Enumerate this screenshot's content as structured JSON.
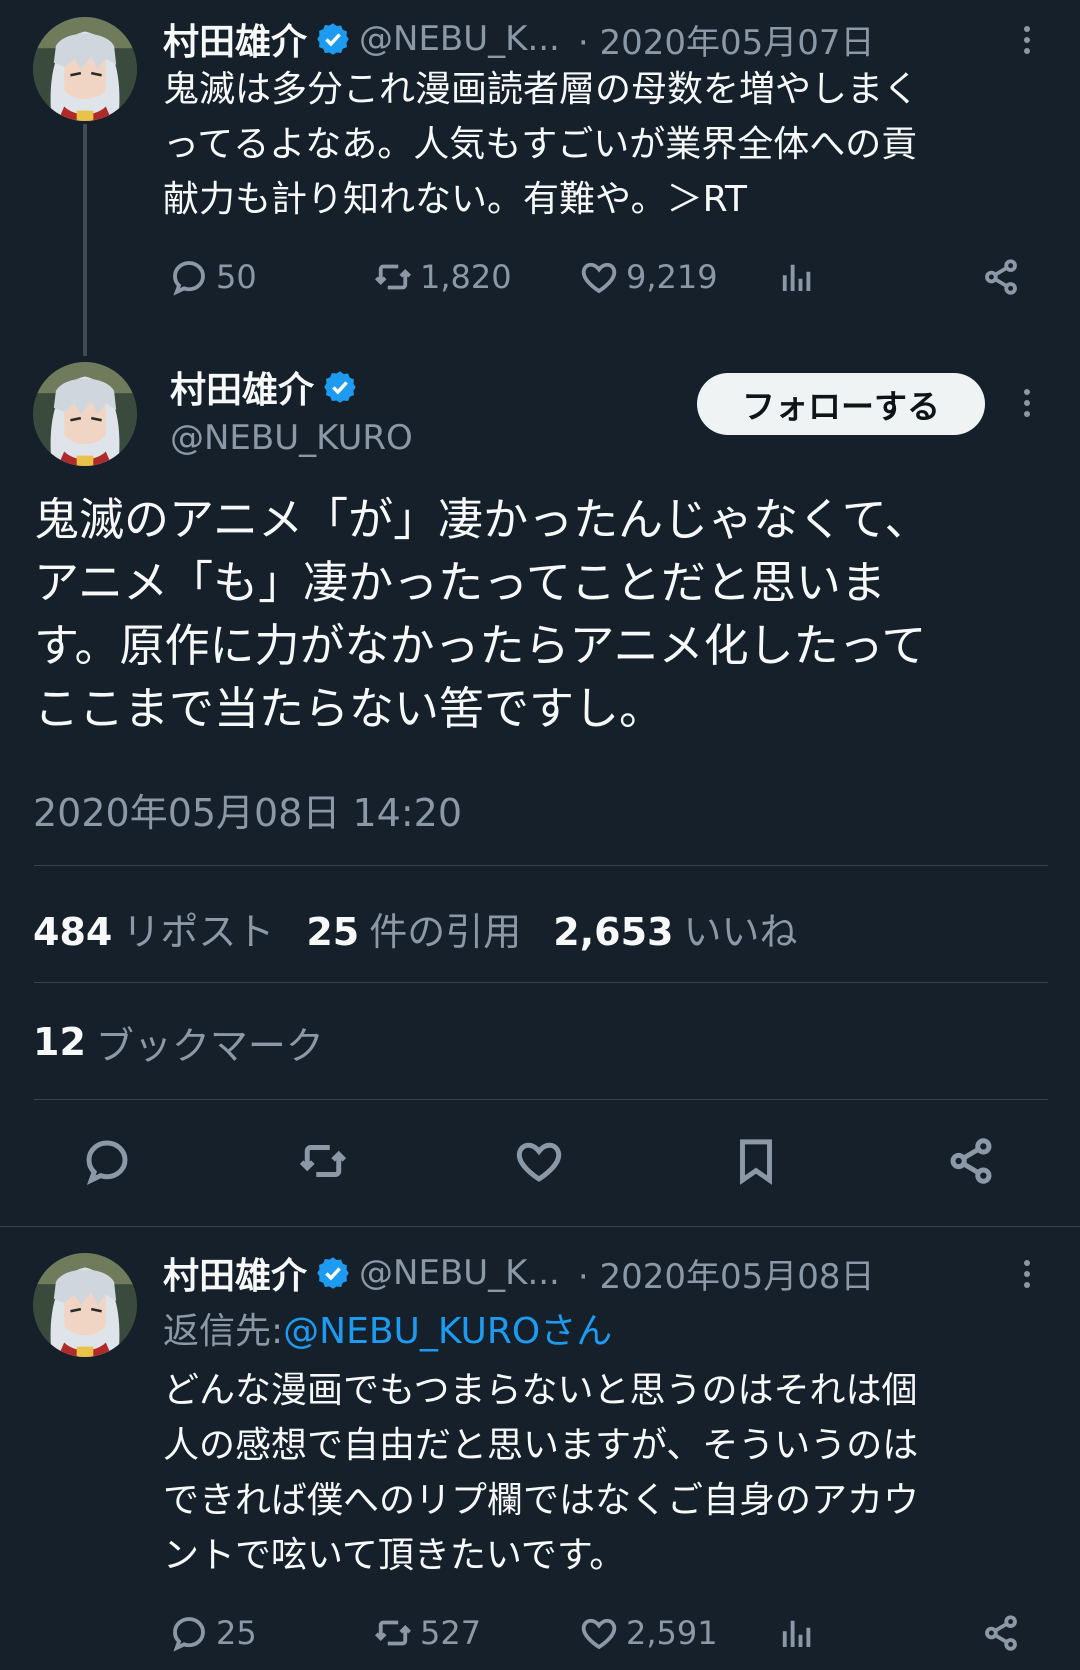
{
  "tweet1": {
    "name": "村田雄介",
    "handle": "@NEBU_K...",
    "date": "· 2020年05月07日",
    "text_lines": [
      "鬼滅は多分これ漫画読者層の母数を増やしまく",
      "ってるよなあ。人気もすごいが業界全体への貢",
      "献力も計り知れない。有難や。＞RT"
    ],
    "replies": "50",
    "retweets": "1,820",
    "likes": "9,219"
  },
  "main": {
    "name": "村田雄介",
    "handle": "@NEBU_KURO",
    "follow_label": "フォローする",
    "text_lines": [
      "鬼滅のアニメ「が」凄かったんじゃなくて、",
      "アニメ「も」凄かったってことだと思いま",
      "す。原作に力がなかったらアニメ化したって",
      "ここまで当たらない筈ですし。"
    ],
    "timestamp": "2020年05月08日 14:20",
    "reposts_count": "484",
    "reposts_label": "リポスト",
    "quotes_count": "25",
    "quotes_label": "件の引用",
    "likes_count": "2,653",
    "likes_label": "いいね",
    "bookmarks_count": "12",
    "bookmarks_label": "ブックマーク"
  },
  "reply": {
    "name": "村田雄介",
    "handle": "@NEBU_K...",
    "date": "· 2020年05月08日",
    "reply_to_prefix": "返信先: ",
    "reply_to_handle": "@NEBU_KUROさん",
    "text_lines": [
      "どんな漫画でもつまらないと思うのはそれは個",
      "人の感想で自由だと思いますが、そういうのは",
      "できれば僕へのリプ欄ではなくご自身のアカウ",
      "ントで呟いて頂きたいです。"
    ],
    "replies": "25",
    "retweets": "527",
    "likes": "2,591"
  },
  "colors": {
    "background": "#15202b",
    "text": "#f7f9f9",
    "muted": "#8b98a5",
    "accent": "#1d9bf0",
    "verified": "#1d9bf0"
  },
  "icons": [
    "reply-icon",
    "retweet-icon",
    "like-icon",
    "views-icon",
    "share-icon",
    "bookmark-icon",
    "verified-badge-icon",
    "more-icon"
  ]
}
